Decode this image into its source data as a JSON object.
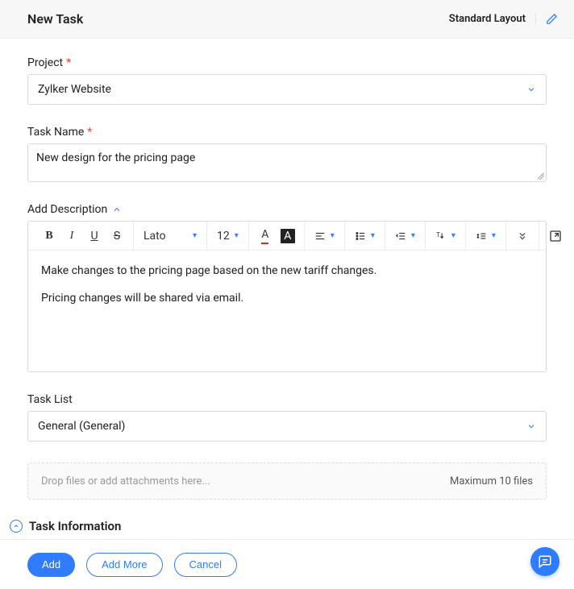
{
  "header": {
    "title": "New Task",
    "layoutLabel": "Standard Layout"
  },
  "labels": {
    "project": "Project",
    "taskName": "Task Name",
    "addDescription": "Add Description",
    "taskList": "Task List",
    "taskInformation": "Task Information"
  },
  "values": {
    "project": "Zylker Website",
    "taskName": "New design for the pricing page",
    "taskList": "General (General)"
  },
  "editor": {
    "font": "Lato",
    "size": "12",
    "lines": [
      "Make changes to the pricing page based on the new tariff changes.",
      "Pricing changes will be shared via email."
    ]
  },
  "dropzone": {
    "placeholder": "Drop files or add attachments here...",
    "limit": "Maximum 10 files"
  },
  "buttons": {
    "add": "Add",
    "addMore": "Add More",
    "cancel": "Cancel"
  }
}
